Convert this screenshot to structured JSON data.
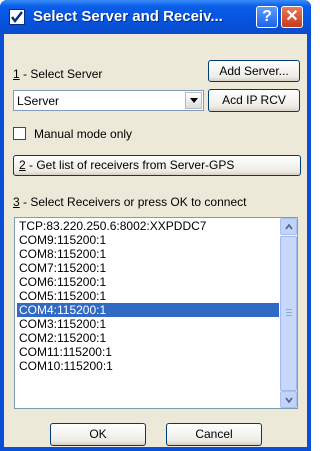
{
  "window": {
    "title": "Select Server and Receiv...",
    "help_glyph": "?",
    "close_glyph": "✕"
  },
  "step1": {
    "number": "1",
    "text": " - Select Server",
    "add_server_button": "Add Server...",
    "add_ip_rcv_button": "Acd IP RCV",
    "server_select": {
      "selected": "LServer"
    }
  },
  "manual_mode": {
    "label": "Manual mode only",
    "checked": false
  },
  "step2": {
    "number": "2",
    "text": " - Get list of receivers from Server-GPS"
  },
  "step3": {
    "number": "3",
    "text": " - Select Receivers or press OK to connect",
    "receivers": [
      "TCP:83.220.250.6:8002:XXPDDC7",
      "COM9:115200:1",
      "COM8:115200:1",
      "COM7:115200:1",
      "COM6:115200:1",
      "COM5:115200:1",
      "COM4:115200:1",
      "COM3:115200:1",
      "COM2:115200:1",
      "COM11:115200:1",
      "COM10:115200:1"
    ],
    "selected_receiver": "COM4:115200:1"
  },
  "footer": {
    "ok_label": "OK",
    "cancel_label": "Cancel"
  },
  "colors": {
    "selection": "#316ac5",
    "titlebar": "#0555e0",
    "client_bg": "#ece9d8"
  },
  "icons": [
    "app-check-icon",
    "help-icon",
    "close-icon",
    "chevron-down-icon",
    "scroll-up-icon",
    "scroll-down-icon"
  ]
}
